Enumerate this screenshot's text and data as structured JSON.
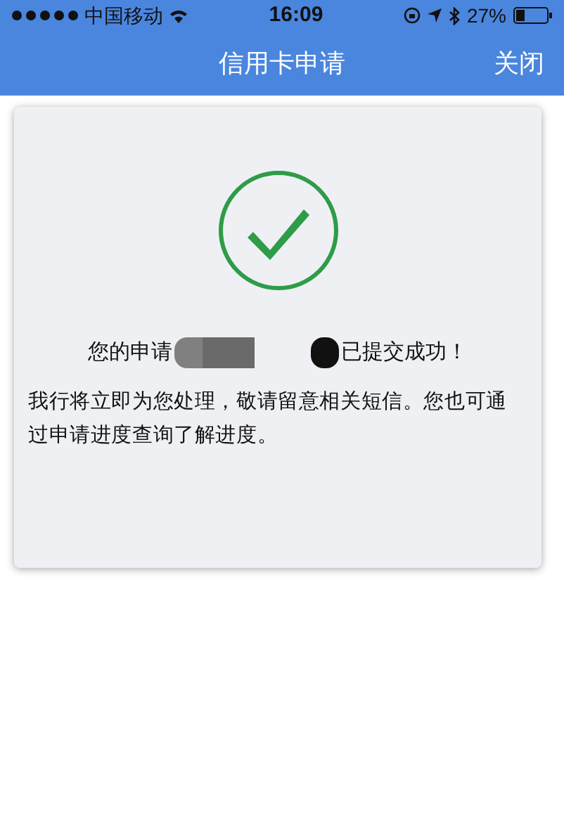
{
  "status_bar": {
    "carrier": "中国移动",
    "time": "16:09",
    "battery": "27%"
  },
  "header": {
    "title": "信用卡申请",
    "close": "关闭"
  },
  "result": {
    "message_start": "您的申请",
    "message_end": "已提交成功！",
    "detail": "我行将立即为您处理，敬请留意相关短信。您也可通过申请进度查询了解进度。"
  }
}
